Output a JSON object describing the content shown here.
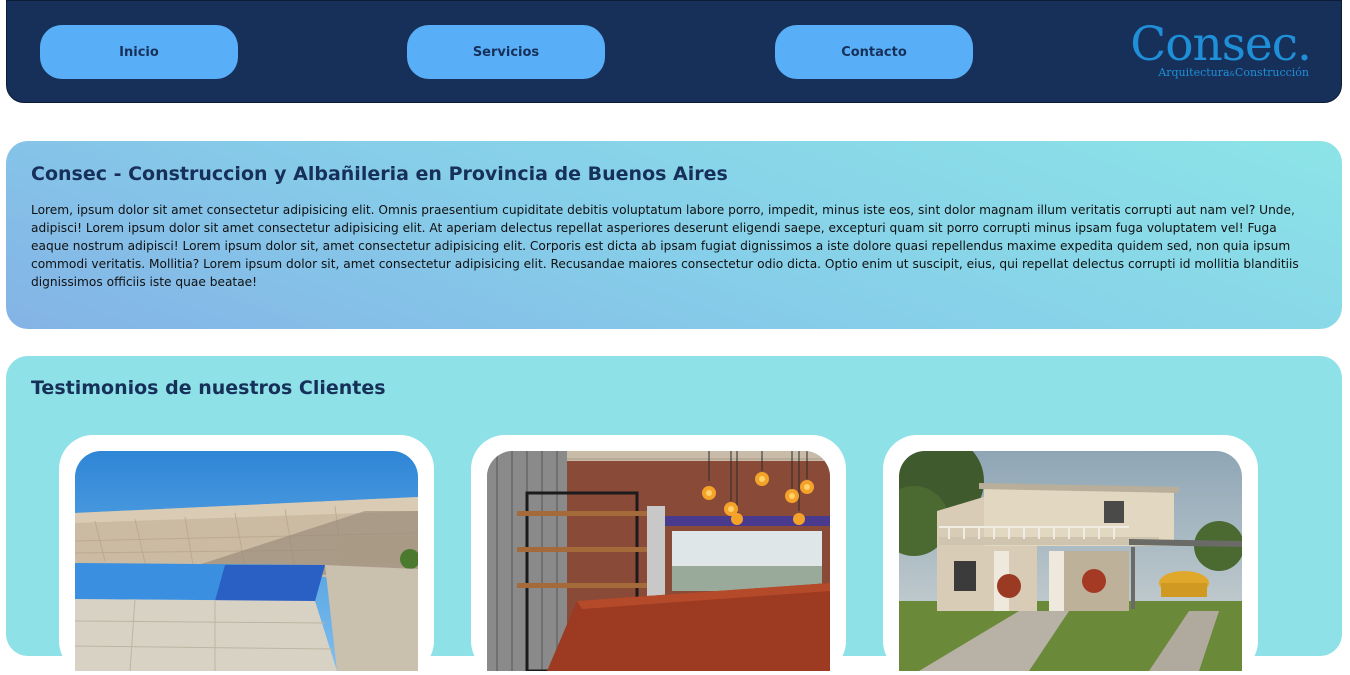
{
  "nav": {
    "items": [
      {
        "label": "Inicio"
      },
      {
        "label": "Servicios"
      },
      {
        "label": "Contacto"
      }
    ]
  },
  "logo": {
    "main": "Consec.",
    "sub_left": "Arquitectura",
    "sub_amp": "&",
    "sub_right": "Construcción"
  },
  "intro": {
    "title": "Consec - Construccion y Albañileria en Provincia de Buenos Aires",
    "body": "Lorem, ipsum dolor sit amet consectetur adipisicing elit. Omnis praesentium cupiditate debitis voluptatum labore porro, impedit, minus iste eos, sint dolor magnam illum veritatis corrupti aut nam vel? Unde, adipisci! Lorem ipsum dolor sit amet consectetur adipisicing elit. At aperiam delectus repellat asperiores deserunt eligendi saepe, excepturi quam sit porro corrupti minus ipsam fuga voluptatem vel! Fuga eaque nostrum adipisci! Lorem ipsum dolor sit, amet consectetur adipisicing elit. Corporis est dicta ab ipsam fugiat dignissimos a iste dolore quasi repellendus maxime expedita quidem sed, non quia ipsum commodi veritatis. Mollitia? Lorem ipsum dolor sit, amet consectetur adipisicing elit. Recusandae maiores consectetur odio dicta. Optio enim ut suscipit, eius, qui repellat delectus corrupti id mollitia blanditiis dignissimos officiis iste quae beatae!"
  },
  "testimonials": {
    "title": "Testimonios de nuestros Clientes"
  },
  "colors": {
    "header_bg": "#17305a",
    "nav_button": "#59aff7",
    "logo": "#1f8fd8",
    "section_bg": "#8ee1e6"
  }
}
